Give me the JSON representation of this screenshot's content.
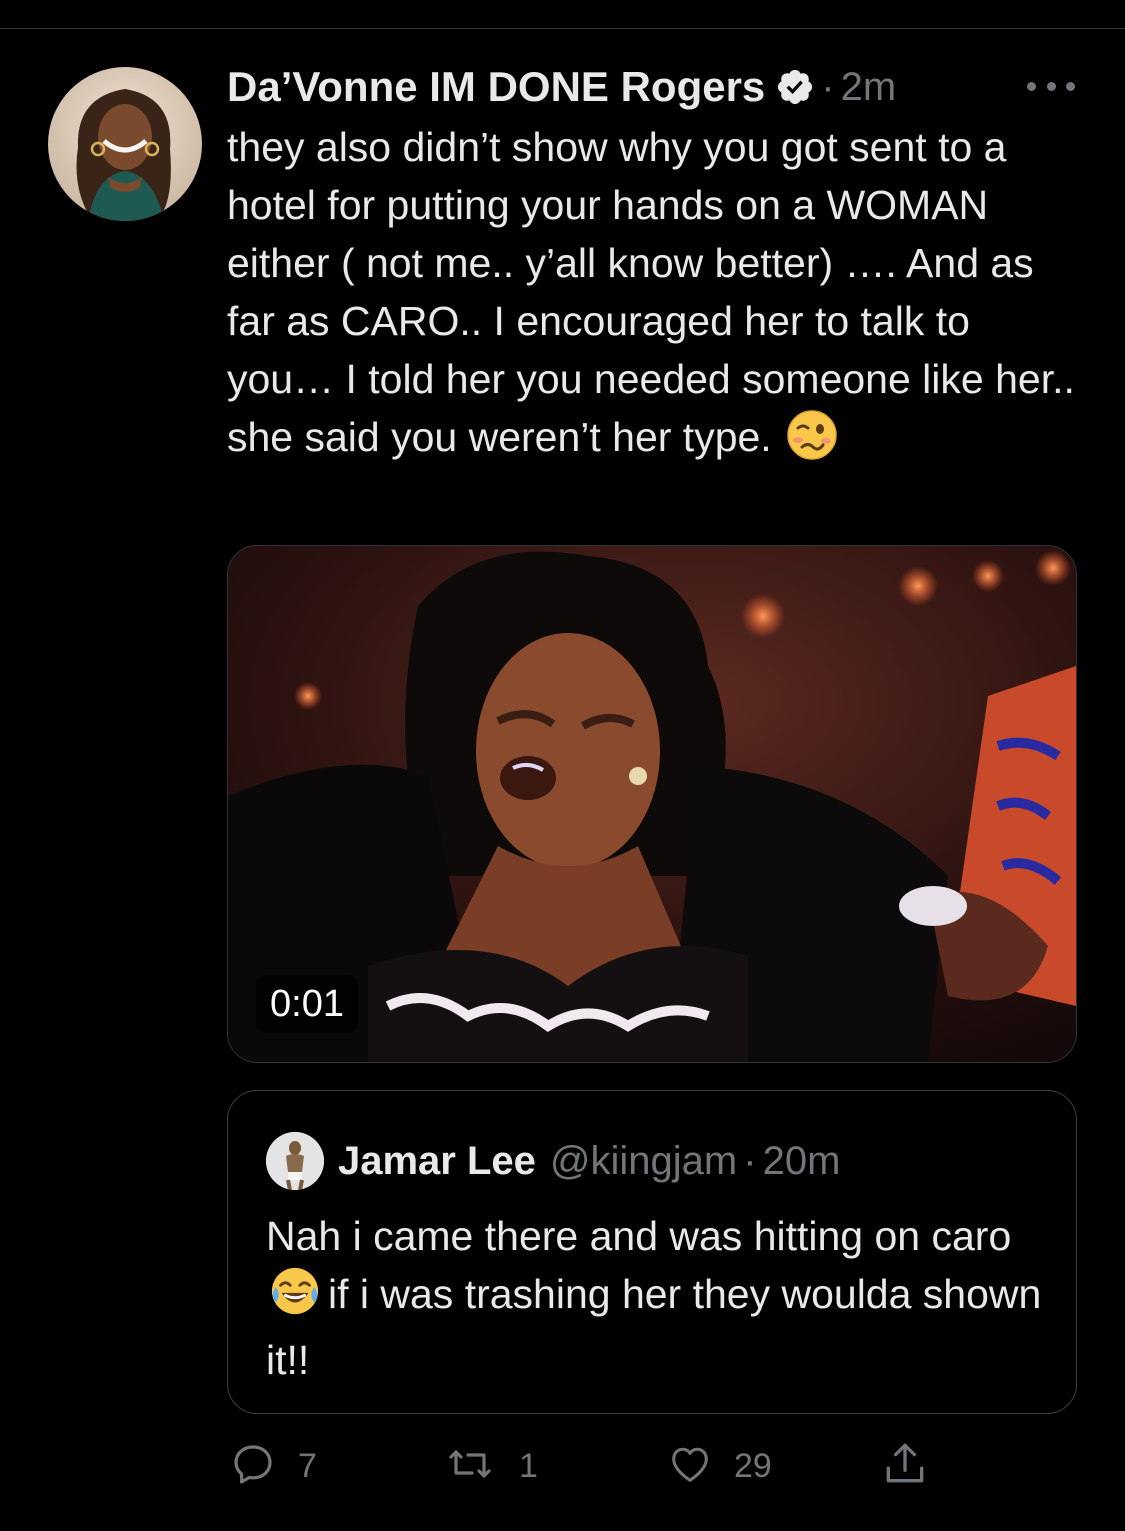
{
  "tweet": {
    "display_name": "Da’Vonne IM DONE Rogers",
    "verified_icon": "verified-badge-icon",
    "separator": "·",
    "timestamp": "2m",
    "more_icon": "more-horizontal-icon",
    "text": "they also didn’t show why you got sent to a hotel for putting your hands on a WOMAN either ( not me.. y’all know better) …. And as far as CARO.. I encouraged her to talk to you… I told her you needed someone like her.. she said you weren’t her type.",
    "text_emoji": "woozy-face-emoji",
    "media": {
      "type": "video",
      "duration": "0:01"
    }
  },
  "quoted_tweet": {
    "display_name": "Jamar Lee",
    "handle": "@kiingjam",
    "separator": "·",
    "timestamp": "20m",
    "text_part1": "Nah i came there and was hitting on caro",
    "text_emoji": "face-with-tears-of-joy-emoji",
    "text_part2": "if i was trashing her they woulda shown it!!"
  },
  "actions": {
    "reply": {
      "icon": "reply-icon",
      "count": "7"
    },
    "retweet": {
      "icon": "retweet-icon",
      "count": "1"
    },
    "like": {
      "icon": "heart-icon",
      "count": "29"
    },
    "share": {
      "icon": "share-icon"
    }
  },
  "colors": {
    "background": "#000000",
    "primary_text": "#e7e9ea",
    "secondary_text": "#71767b",
    "border": "#2f3336"
  }
}
